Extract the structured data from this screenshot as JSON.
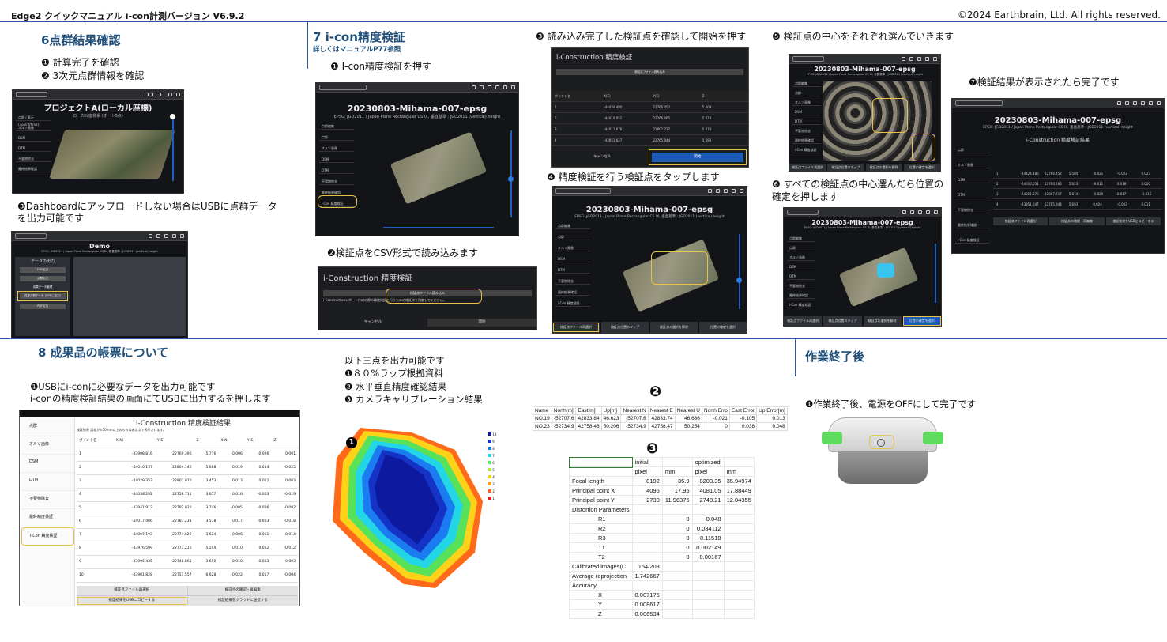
{
  "header": {
    "title": "Edge2 クイックマニュアル i-con計測バージョン V6.9.2",
    "copyright": "©2024 Earthbrain, Ltd. All rights reserved."
  },
  "s6": {
    "title": "6点群結果確認",
    "step1": "❶ 計算完了を確認",
    "step2": "❷ 3次元点群情報を確認",
    "project_title": "プロジェクトA(ローカル座標)",
    "project_sub": "ローカル座標系 (オート5点)",
    "side": [
      "点群 / 表示 (3point/6m2)",
      "オルソ画像",
      "DSM",
      "DTM",
      "不要物除去",
      "最終結果確認"
    ],
    "step3a": "❸Dashboardにアップロードしない場合はUSBに点群データ",
    "step3b": "を出力可能です",
    "demo_title": "Demo",
    "demo_sub": "EPSG: JGD2011 / Japan Plane Rectangular CS IX, 垂直基準 : JGD2011 (vertical) height",
    "panel_title": "データの出力",
    "panel_items": [
      "DXF出力",
      "点群出力",
      "成果データ管理",
      "成果点群データ (USBに出力)",
      "PDF出力"
    ]
  },
  "s7": {
    "title": "7 i-con精度検証",
    "subtitle": "詳しくはマニュアルP77参照",
    "step1": "❶ I-con精度検証を押す",
    "step2": "❷検証点をCSV形式で読み込みます",
    "step3": "❸ 読み込み完了した検証点を確認して開始を押す",
    "step4": "❹ 精度検証を行う検証点をタップします",
    "step5": "❺ 検証点の中心をそれぞれ選んでいきます",
    "step6a": "❻ すべての検証点の中心選んだら位置の",
    "step6b": "確定を押します",
    "step7": "❼検証結果が表示されたら完了です",
    "scr_title": "20230803-Mihama-007-epsg",
    "scr_sub": "EPSG: JGD2011 / Japan Plane Rectangular CS IX, 垂直基準 : JGD2011 (vertical) height",
    "side": [
      "点群編集",
      "点群",
      "オルソ画像",
      "DSM",
      "DTM",
      "不要物除去",
      "最終結果確認",
      "i-Con 精度検証"
    ],
    "dialog_title": "i-Construction 精度検証",
    "dialog_load": "検証点ファイル読み込み",
    "dialog_msg": "i-Constructionレポート作成の際の精度検証を行うための検証点を指定してください。",
    "cancel": "キャンセル",
    "start": "開始",
    "check_cols": [
      "ポイント名",
      "X(E)",
      "Y(E)",
      "Z"
    ],
    "check_rows": [
      [
        "1",
        "-44424.480",
        "22766.452",
        "5.509"
      ],
      [
        "2",
        "-44010.051",
        "22766.465",
        "5.623"
      ],
      [
        "3",
        "-44011.676",
        "22807.717",
        "5.674"
      ],
      [
        "4",
        "-43951.647",
        "22765.944",
        "5.693"
      ]
    ],
    "bottom_btns": [
      "検証点ファイル再選択",
      "検証点位置のタップ",
      "検証点の選択を解除",
      "位置の確定を選択"
    ],
    "result_title": "i-Construction 精度検証結果",
    "result_btns": [
      "検証点ファイル再選択",
      "検証点の確認・再編集",
      "検証結果をUSBにコピーする"
    ],
    "result_rows": [
      [
        "1",
        "-44424.480",
        "22766.452",
        "5.504",
        "-0.021",
        "-0.022",
        "0.023"
      ],
      [
        "2",
        "-44010.051",
        "22780.465",
        "5.623",
        "-0.011",
        "0.018",
        "0.020"
      ],
      [
        "3",
        "-44011.676",
        "22807.717",
        "5.674",
        "-0.029",
        "0.017",
        "-0.016"
      ],
      [
        "4",
        "-43951.647",
        "22785.944",
        "5.693",
        "0.024",
        "-0.002",
        "0.011"
      ]
    ]
  },
  "s8": {
    "title": "8 成果品の帳票について",
    "step1": "❶USBにi-conに必要なデータを出力可能です",
    "step2": "i-conの精度検証結果の画面にてUSBに出力するを押します",
    "tablet_title": "i-Construction 精度検証結果",
    "tablet_note": "検証結果 誤差が±50mm以上のものは赤文字で表示されます。",
    "side": [
      "点群",
      "オルソ画像",
      "DSM",
      "DTM",
      "不要物除去",
      "最終精度検証",
      "i-Con 精度検証"
    ],
    "cols": [
      "ポイント名",
      "X(N)",
      "Y(E)",
      "Z",
      "X(N)",
      "Y(E)",
      "Z"
    ],
    "rows": [
      [
        "1",
        "-43998.816",
        "22769.390",
        "5.776",
        "-0.006",
        "-0.026",
        "0.001"
      ],
      [
        "2",
        "-44010.137",
        "22804.140",
        "5.688",
        "0.019",
        "0.014",
        "-0.025"
      ],
      [
        "3",
        "-44029.353",
        "22807.970",
        "3.453",
        "0.013",
        "0.012",
        "0.003"
      ],
      [
        "4",
        "-44038.292",
        "22758.711",
        "3.657",
        "0.016",
        "-0.003",
        "-0.019"
      ],
      [
        "5",
        "-43941.913",
        "22792.020",
        "3.746",
        "-0.005",
        "-0.006",
        "-0.002"
      ],
      [
        "6",
        "-44017.466",
        "22787.233",
        "3.578",
        "-0.017",
        "-0.003",
        "-0.018"
      ],
      [
        "7",
        "-44007.193",
        "22774.822",
        "3.624",
        "0.006",
        "0.011",
        "0.014"
      ],
      [
        "8",
        "-43976.599",
        "22771.210",
        "5.544",
        "0.010",
        "0.012",
        "-0.012"
      ],
      [
        "9",
        "-43996.435",
        "22748.865",
        "3.650",
        "-0.010",
        "-0.013",
        "-0.003"
      ],
      [
        "10",
        "-43981.828",
        "22751.557",
        "6.628",
        "-0.022",
        "0.017",
        "-0.004"
      ]
    ],
    "btns": [
      "検証点ファイル再選択",
      "検証点の確認・再編集",
      "検証結果をUSBにコピーする",
      "検証結果をクラウドに送信する"
    ],
    "out_intro": "以下三点を出力可能です",
    "out1": "❶８０%ラップ根拠資料",
    "out2": "❷ 水平垂直精度確認結果",
    "out3": "❸ カメラキャリブレーション結果",
    "acc_head": [
      "Name",
      "North[m]",
      "East[m]",
      "Up[m]",
      "Nearest N",
      "Nearest E",
      "Nearest U",
      "North Erro",
      "East Error",
      "Up Error[m]"
    ],
    "acc_rows": [
      [
        "NO.19",
        "-52707.6",
        "42833.84",
        "46.623",
        "-52707.6",
        "42833.74",
        "46.636",
        "-0.021",
        "-0.105",
        "0.013"
      ],
      [
        "NO.23",
        "-52734.9",
        "42758.43",
        "50.206",
        "-52734.9",
        "42758.47",
        "50.254",
        "0",
        "0.038",
        "0.048"
      ]
    ],
    "cal_rows": [
      [
        "",
        "initial",
        "",
        "optimized",
        ""
      ],
      [
        "",
        "pixel",
        "mm",
        "pixel",
        "mm"
      ],
      [
        "Focal length",
        "8192",
        "35.9",
        "8203.35",
        "35.94974"
      ],
      [
        "Principal point X",
        "4096",
        "17.95",
        "4081.05",
        "17.88449"
      ],
      [
        "Principal point Y",
        "2730",
        "11.96375",
        "2748.21",
        "12.04355"
      ],
      [
        "Distortion Parameters",
        "",
        "",
        "",
        ""
      ],
      [
        "R1",
        "",
        "0",
        "-0.048",
        ""
      ],
      [
        "R2",
        "",
        "0",
        "0.034112",
        ""
      ],
      [
        "R3",
        "",
        "0",
        "-0.11518",
        ""
      ],
      [
        "T1",
        "",
        "0",
        "0.002149",
        ""
      ],
      [
        "T2",
        "",
        "0",
        "-0.00167",
        ""
      ],
      [
        "Calibrated images(C",
        "154/203",
        "",
        "",
        ""
      ],
      [
        "Average reprojection",
        "1.742667",
        "",
        "",
        ""
      ],
      [
        "Accuracy",
        "",
        "",
        "",
        ""
      ],
      [
        "X",
        "0.007175",
        "",
        "",
        ""
      ],
      [
        "Y",
        "0.008617",
        "",
        "",
        ""
      ],
      [
        "Z",
        "0.006534",
        "",
        "",
        ""
      ]
    ],
    "legend": [
      "19",
      "9",
      "8",
      "7",
      "6",
      "5",
      "4",
      "3",
      "2",
      "1"
    ]
  },
  "end": {
    "title": "作業終了後",
    "step1": "❶作業終了後、電源をOFFにして完了です"
  },
  "colors": {
    "accent": "#1f4e79",
    "highlight": "#e8c14a",
    "button_blue": "#1e5bb8"
  }
}
